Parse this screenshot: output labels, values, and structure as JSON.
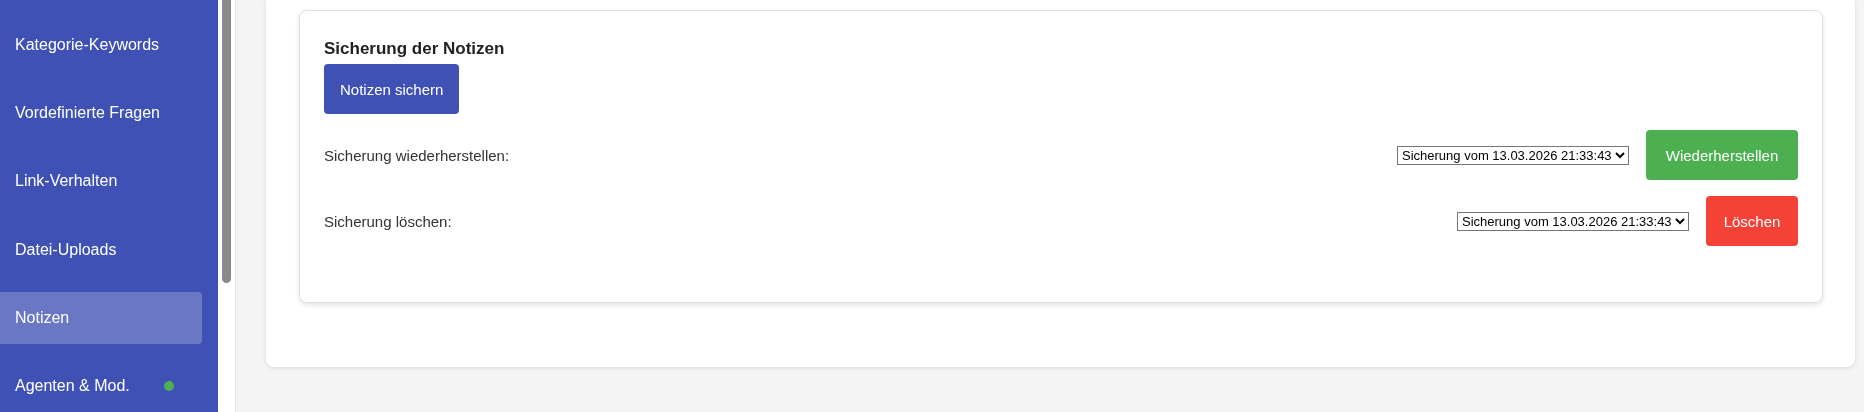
{
  "sidebar": {
    "items": [
      {
        "label": "Kategorie-Keywords",
        "selected": false
      },
      {
        "label": "Vordefinierte Fragen",
        "selected": false
      },
      {
        "label": "Link-Verhalten",
        "selected": false
      },
      {
        "label": "Datei-Uploads",
        "selected": false
      },
      {
        "label": "Notizen",
        "selected": true
      },
      {
        "label": "Agenten & Mod.",
        "selected": false,
        "color": "#4caf50"
      }
    ]
  },
  "backup_card": {
    "title": "Sicherung der Notizen",
    "save_button": {
      "label": "Notizen sichern",
      "kind": "primary"
    },
    "rows": [
      {
        "label": "Sicherung wiederherstellen:",
        "select_value": "Sicherung vom 13.03.2026 21:33:43",
        "button": {
          "label": "Wiederherstellen",
          "kind": "success"
        }
      },
      {
        "label": "Sicherung löschen:",
        "select_value": "Sicherung vom 13.03.2026 21:33:43",
        "button": {
          "label": "Löschen",
          "kind": "danger"
        }
      }
    ]
  }
}
